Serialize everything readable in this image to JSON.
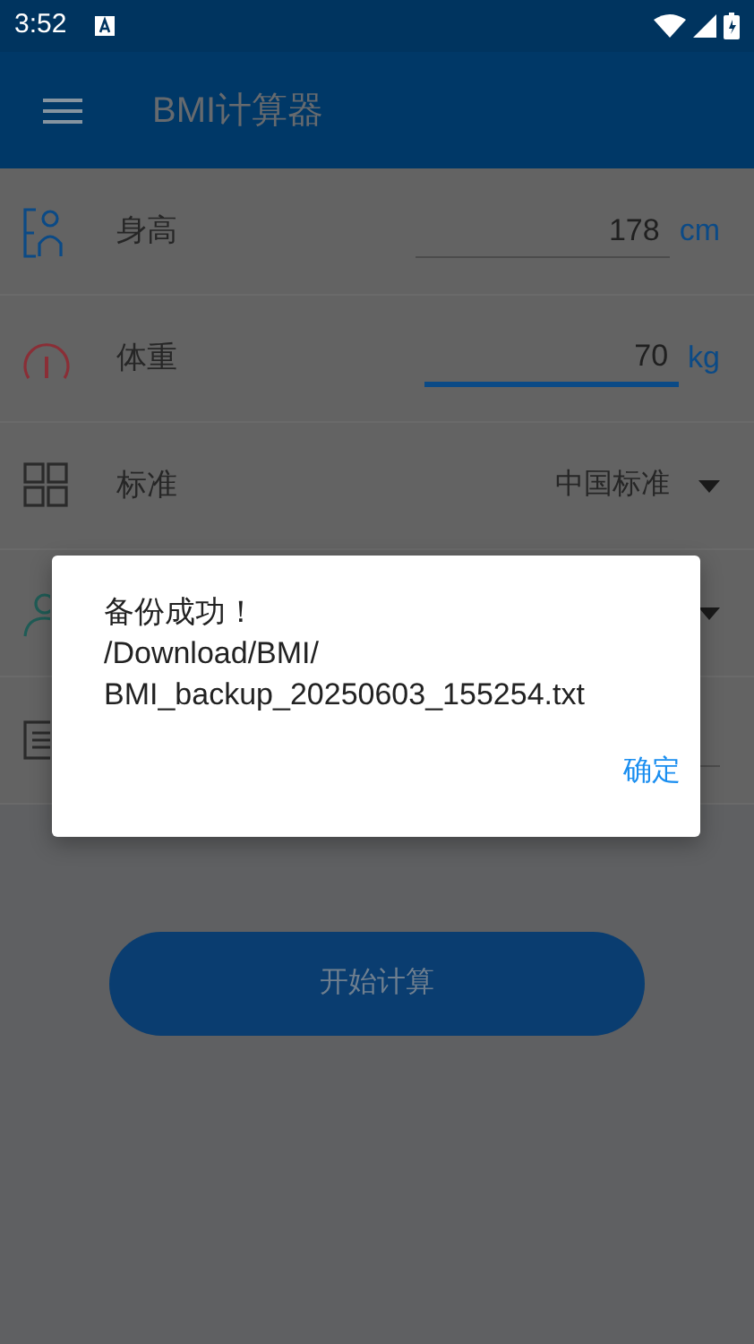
{
  "status_bar": {
    "time": "3:52"
  },
  "app_bar": {
    "title": "BMI计算器"
  },
  "rows": [
    {
      "kind": "input",
      "label": "身高",
      "value": "178",
      "unit": "cm",
      "focused": false
    },
    {
      "kind": "input",
      "label": "体重",
      "value": "70",
      "unit": "kg",
      "focused": true
    },
    {
      "kind": "select",
      "label": "标准",
      "value": "中国标准"
    },
    {
      "kind": "select"
    },
    {
      "kind": "input",
      "focused": false
    }
  ],
  "primary_button": {
    "label": "开始计算"
  },
  "dialog": {
    "message_lines": [
      "备份成功！",
      "/Download/BMI/",
      "BMI_backup_20250603_155254.txt"
    ],
    "button": "确定"
  }
}
